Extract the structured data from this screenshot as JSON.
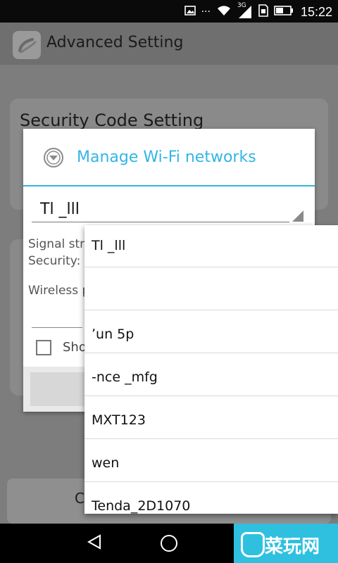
{
  "status_bar": {
    "time": "15:22",
    "network_label": "3G",
    "icons": [
      "image-icon",
      "more-icon",
      "wifi-icon",
      "signal-icon",
      "sim-icon",
      "battery-icon"
    ],
    "more_glyph": "···"
  },
  "app": {
    "title": "Advanced Setting",
    "logo_icon": "app-logo-icon"
  },
  "background": {
    "section_title": "Security Code Setting",
    "bottom_button_partial": "C"
  },
  "dialog": {
    "title": "Manage Wi-Fi networks",
    "title_icon": "wifi-manage-icon",
    "accent_color": "#33b5e5",
    "selected_network": "Tl _lll",
    "signal_label": "Signal stre",
    "security_label": "Security: ",
    "password_label": "Wireless p",
    "show_password_label": "Sho"
  },
  "dropdown": {
    "options": [
      "Tl _lll",
      "",
      "ʼun 5p",
      "-nce   _mfg",
      "MXT123",
      "wen",
      "Tenda_2D1070"
    ]
  },
  "nav_bar": {
    "buttons": [
      "back-icon",
      "home-icon"
    ]
  },
  "watermark": {
    "text": "菜玩网",
    "brand_color": "#2fc0e0"
  }
}
